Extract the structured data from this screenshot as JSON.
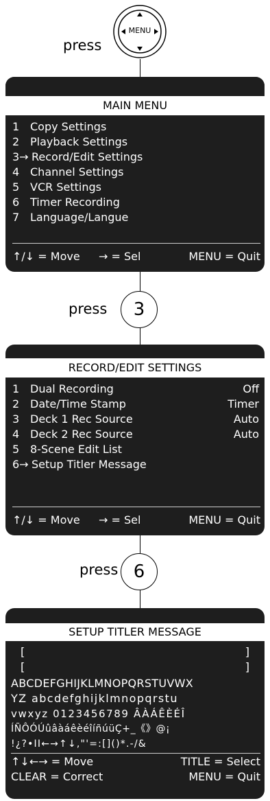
{
  "steps": [
    {
      "press_label": "press",
      "key": "MENU"
    },
    {
      "press_label": "press",
      "key": "3"
    },
    {
      "press_label": "press",
      "key": "6"
    }
  ],
  "main_menu": {
    "title": "MAIN MENU",
    "items": [
      {
        "num": "1",
        "label": "Copy Settings"
      },
      {
        "num": "2",
        "label": "Playback Settings"
      },
      {
        "num": "3→",
        "label": "Record/Edit Settings"
      },
      {
        "num": "4",
        "label": "Channel Settings"
      },
      {
        "num": "5",
        "label": "VCR Settings"
      },
      {
        "num": "6",
        "label": "Timer Recording"
      },
      {
        "num": "7",
        "label": "Language/Langue"
      }
    ],
    "footer": {
      "move": "↑/↓ = Move",
      "sel": "→ = Sel",
      "quit": "MENU = Quit"
    }
  },
  "record_edit": {
    "title": "RECORD/EDIT SETTINGS",
    "items": [
      {
        "num": "1",
        "label": "Dual Recording",
        "value": "Off"
      },
      {
        "num": "2",
        "label": "Date/Time Stamp",
        "value": "Timer"
      },
      {
        "num": "3",
        "label": "Deck 1 Rec Source",
        "value": "Auto"
      },
      {
        "num": "4",
        "label": "Deck 2 Rec Source",
        "value": "Auto"
      },
      {
        "num": "5",
        "label": "8-Scene Edit List",
        "value": ""
      },
      {
        "num": "6→",
        "label": "Setup Titler Message",
        "value": ""
      }
    ],
    "footer": {
      "move": "↑/↓ = Move",
      "sel": "→ = Sel",
      "quit": "MENU = Quit"
    }
  },
  "titler": {
    "title": "SETUP TITLER MESSAGE",
    "bracket_open": "[",
    "bracket_close": "]",
    "char_rows": [
      "ABCDEFGHIJKLMNOPQRSTUVWX",
      "YZ abcdefghijklmnopqrstu",
      "vwxyz 0123456789  ÂÀÁÊÈÉÎ",
      "ÍÑÔÓÚûâàáêèéîíñúüÇ+_《》@¡",
      "!¿?•ΙΙ←→↑↓,\"'=:[]()*.-/&"
    ],
    "footer": {
      "move": "↑↓←→ = Move",
      "select": "TITLE = Select",
      "correct": "CLEAR = Correct",
      "quit": "MENU = Quit"
    }
  }
}
